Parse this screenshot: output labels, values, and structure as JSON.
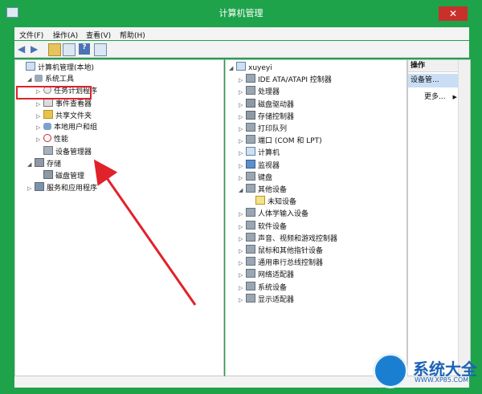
{
  "window": {
    "title": "计算机管理",
    "close_label": "✕"
  },
  "menu": [
    "文件(F)",
    "操作(A)",
    "查看(V)",
    "帮助(H)"
  ],
  "toolbar": {
    "buttons": [
      "back-icon",
      "forward-icon",
      "up-icon",
      "show-hide-icon",
      "help-icon",
      "properties-icon"
    ]
  },
  "left_tree": [
    {
      "label": "计算机管理(本地)",
      "level": 0,
      "arrow": "",
      "icon": "computer-icon"
    },
    {
      "label": "系统工具",
      "level": 1,
      "arrow": "◢",
      "icon": "tools-icon"
    },
    {
      "label": "任务计划程序",
      "level": 2,
      "arrow": "▷",
      "icon": "clock-icon"
    },
    {
      "label": "事件查看器",
      "level": 2,
      "arrow": "▷",
      "icon": "log-icon"
    },
    {
      "label": "共享文件夹",
      "level": 2,
      "arrow": "▷",
      "icon": "folder-icon"
    },
    {
      "label": "本地用户和组",
      "level": 2,
      "arrow": "▷",
      "icon": "users-icon"
    },
    {
      "label": "性能",
      "level": 2,
      "arrow": "▷",
      "icon": "performance-icon"
    },
    {
      "label": "设备管理器",
      "level": 2,
      "arrow": "",
      "icon": "device-manager-icon"
    },
    {
      "label": "存储",
      "level": 1,
      "arrow": "◢",
      "icon": "storage-icon"
    },
    {
      "label": "磁盘管理",
      "level": 2,
      "arrow": "",
      "icon": "disk-icon"
    },
    {
      "label": "服务和应用程序",
      "level": 1,
      "arrow": "▷",
      "icon": "services-icon"
    }
  ],
  "device_tree": [
    {
      "label": "xuyeyi",
      "level": 0,
      "arrow": "◢",
      "icon": "computer-icon"
    },
    {
      "label": "IDE ATA/ATAPI 控制器",
      "level": 1,
      "arrow": "▷",
      "icon": "ide-icon"
    },
    {
      "label": "处理器",
      "level": 1,
      "arrow": "▷",
      "icon": "cpu-icon"
    },
    {
      "label": "磁盘驱动器",
      "level": 1,
      "arrow": "▷",
      "icon": "disk-icon"
    },
    {
      "label": "存储控制器",
      "level": 1,
      "arrow": "▷",
      "icon": "storage-icon"
    },
    {
      "label": "打印队列",
      "level": 1,
      "arrow": "▷",
      "icon": "printer-icon"
    },
    {
      "label": "端口 (COM 和 LPT)",
      "level": 1,
      "arrow": "▷",
      "icon": "port-icon"
    },
    {
      "label": "计算机",
      "level": 1,
      "arrow": "▷",
      "icon": "computer-icon"
    },
    {
      "label": "监视器",
      "level": 1,
      "arrow": "▷",
      "icon": "monitor-icon"
    },
    {
      "label": "键盘",
      "level": 1,
      "arrow": "▷",
      "icon": "keyboard-icon"
    },
    {
      "label": "其他设备",
      "level": 1,
      "arrow": "◢",
      "icon": "other-devices-icon"
    },
    {
      "label": "未知设备",
      "level": 2,
      "arrow": "",
      "icon": "warning-icon"
    },
    {
      "label": "人体学输入设备",
      "level": 1,
      "arrow": "▷",
      "icon": "hid-icon"
    },
    {
      "label": "软件设备",
      "level": 1,
      "arrow": "▷",
      "icon": "software-device-icon"
    },
    {
      "label": "声音、视频和游戏控制器",
      "level": 1,
      "arrow": "▷",
      "icon": "sound-icon"
    },
    {
      "label": "鼠标和其他指针设备",
      "level": 1,
      "arrow": "▷",
      "icon": "mouse-icon"
    },
    {
      "label": "通用串行总线控制器",
      "level": 1,
      "arrow": "▷",
      "icon": "usb-icon"
    },
    {
      "label": "网络适配器",
      "level": 1,
      "arrow": "▷",
      "icon": "network-icon"
    },
    {
      "label": "系统设备",
      "level": 1,
      "arrow": "▷",
      "icon": "system-device-icon"
    },
    {
      "label": "显示适配器",
      "level": 1,
      "arrow": "▷",
      "icon": "display-icon"
    }
  ],
  "actions": {
    "header": "操作",
    "selected": "设备管...",
    "more": "更多..."
  },
  "watermark": {
    "brand": "系统大全",
    "url": "WWW.XP85.COM"
  },
  "colors": {
    "frame": "#1ea34a",
    "highlight": "#e0222a",
    "selection": "#c9def4"
  }
}
